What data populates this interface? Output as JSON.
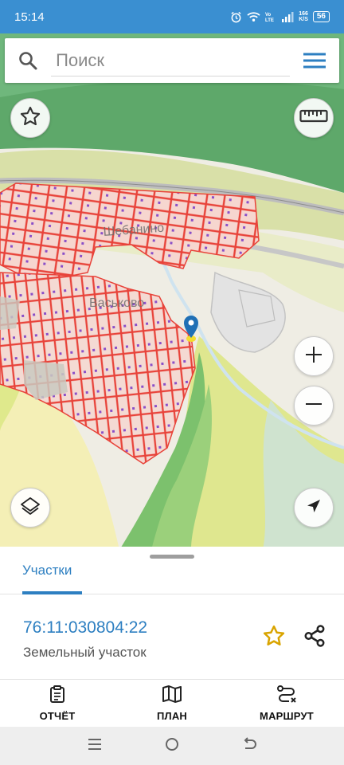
{
  "status_bar": {
    "time": "15:14",
    "speed_value": "166",
    "speed_unit": "K/S",
    "battery": "56"
  },
  "search": {
    "placeholder": "Поиск"
  },
  "map": {
    "place_labels": [
      "Шебанино",
      "Васьково"
    ]
  },
  "sheet": {
    "tab_label": "Участки",
    "parcel": {
      "number": "76:11:030804:22",
      "type": "Земельный участок"
    }
  },
  "actions": {
    "report": "ОТЧЁТ",
    "plan": "ПЛАН",
    "route": "МАРШРУТ"
  },
  "colors": {
    "accent": "#2d7fc1",
    "status_bar": "#3a8fd1",
    "parcel_outline": "#e8433a",
    "marker": "#1f6fb5",
    "favorite_star": "#d9a400"
  }
}
